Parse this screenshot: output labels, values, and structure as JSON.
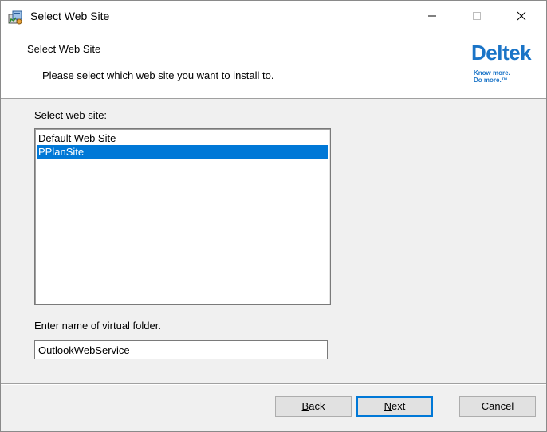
{
  "window": {
    "title": "Select Web Site",
    "icon": "installer-package-icon"
  },
  "banner": {
    "title": "Select Web Site",
    "description": "Please select which web site you want to install to.",
    "logo": {
      "word": "Deltek",
      "tagline_line1": "Know more.",
      "tagline_line2": "Do more.™",
      "color": "#1a74c7"
    }
  },
  "body": {
    "site_list_label": "Select web site:",
    "sites": [
      {
        "label": "Default Web Site",
        "selected": false
      },
      {
        "label": "PPlanSite",
        "selected": true
      }
    ],
    "folder_label": "Enter name of virtual folder.",
    "folder_value": "OutlookWebService"
  },
  "footer": {
    "back": {
      "accel": "B",
      "rest": "ack"
    },
    "next": {
      "accel": "N",
      "rest": "ext"
    },
    "cancel": "Cancel"
  },
  "colors": {
    "selection": "#0078d7",
    "default_button_border": "#0078d7"
  }
}
